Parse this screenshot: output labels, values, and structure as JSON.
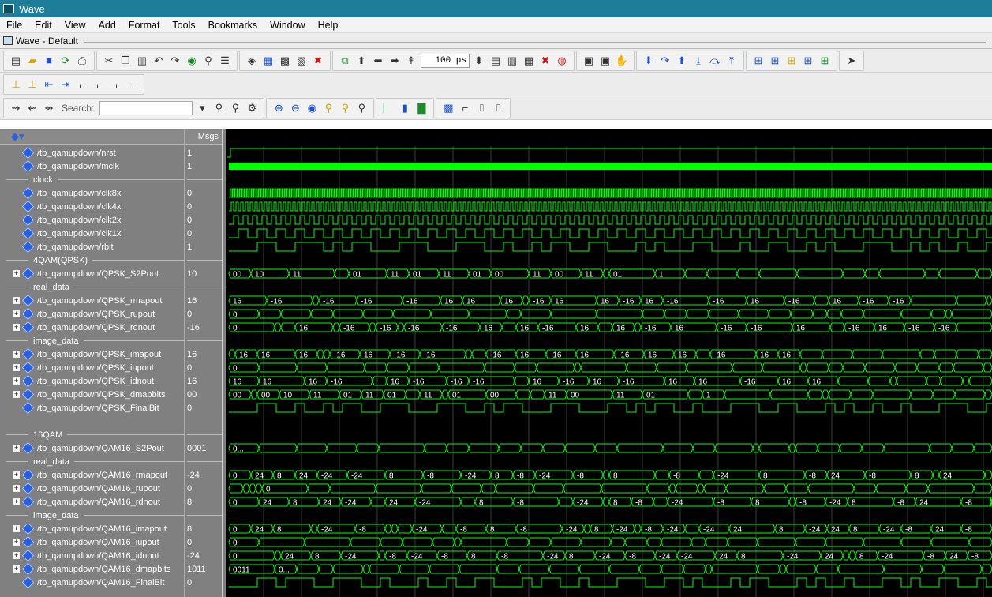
{
  "window": {
    "title": "Wave"
  },
  "menu": [
    "File",
    "Edit",
    "View",
    "Add",
    "Format",
    "Tools",
    "Bookmarks",
    "Window",
    "Help"
  ],
  "pane": {
    "title": "Wave - Default"
  },
  "toolbar": {
    "time_value": "100 ps",
    "search_label": "Search:"
  },
  "columns": {
    "msgs": "Msgs"
  },
  "colors": {
    "wave": "#00ff00",
    "background": "#000000",
    "panel": "#808080"
  },
  "signals": [
    {
      "type": "sig",
      "name": "/tb_qamupdown/nrst",
      "value": "1",
      "expand": false,
      "kind": "bit",
      "pattern": "nrst"
    },
    {
      "type": "sig",
      "name": "/tb_qamupdown/mclk",
      "value": "1",
      "expand": false,
      "kind": "bit",
      "pattern": "mclk"
    },
    {
      "type": "div",
      "name": "clock"
    },
    {
      "type": "sig",
      "name": "/tb_qamupdown/clk8x",
      "value": "0",
      "expand": false,
      "kind": "bit",
      "pattern": "clk8x"
    },
    {
      "type": "sig",
      "name": "/tb_qamupdown/clk4x",
      "value": "0",
      "expand": false,
      "kind": "bit",
      "pattern": "clk4x"
    },
    {
      "type": "sig",
      "name": "/tb_qamupdown/clk2x",
      "value": "0",
      "expand": false,
      "kind": "bit",
      "pattern": "clk2x"
    },
    {
      "type": "sig",
      "name": "/tb_qamupdown/clk1x",
      "value": "0",
      "expand": false,
      "kind": "bit",
      "pattern": "clk1x"
    },
    {
      "type": "sig",
      "name": "/tb_qamupdown/rbit",
      "value": "1",
      "expand": false,
      "kind": "bit",
      "pattern": "rbit"
    },
    {
      "type": "div",
      "name": "4QAM(QPSK)"
    },
    {
      "type": "sig",
      "name": "/tb_qamupdown/QPSK_S2Pout",
      "value": "10",
      "expand": true,
      "kind": "bus",
      "labels": [
        "00",
        "10",
        "11",
        "01",
        "11",
        "01",
        "11",
        "01",
        "00",
        "11",
        "00",
        "11",
        "01",
        "1"
      ]
    },
    {
      "type": "div",
      "name": "real_data"
    },
    {
      "type": "sig",
      "name": "/tb_qamupdown/QPSK_rmapout",
      "value": "16",
      "expand": true,
      "kind": "bus",
      "labels": [
        "16",
        "-16",
        "-16",
        "-16",
        "-16",
        "16",
        "16",
        "16",
        "-16",
        "16",
        "16",
        "-16",
        "16",
        "-16",
        "-16",
        "16",
        "-16",
        "16",
        "-16",
        "-16"
      ]
    },
    {
      "type": "sig",
      "name": "/tb_qamupdown/QPSK_rupout",
      "value": "0",
      "expand": true,
      "kind": "bus",
      "labels": [
        "0"
      ]
    },
    {
      "type": "sig",
      "name": "/tb_qamupdown/QPSK_rdnout",
      "value": "-16",
      "expand": true,
      "kind": "bus",
      "labels": [
        "0",
        "16",
        "-16",
        "-16",
        "-16",
        "-16",
        "16",
        "16",
        "-16",
        "16",
        "16",
        "-16",
        "16",
        "-16",
        "-16",
        "16",
        "-16",
        "16",
        "-16",
        "-16"
      ]
    },
    {
      "type": "div",
      "name": "image_data"
    },
    {
      "type": "sig",
      "name": "/tb_qamupdown/QPSK_imapout",
      "value": "16",
      "expand": true,
      "kind": "bus",
      "labels": [
        "16",
        "16",
        "16",
        "-16",
        "16",
        "-16",
        "-16",
        "-16",
        "16",
        "-16",
        "16",
        "-16",
        "16",
        "16",
        "-16",
        "16",
        "16"
      ]
    },
    {
      "type": "sig",
      "name": "/tb_qamupdown/QPSK_iupout",
      "value": "0",
      "expand": true,
      "kind": "bus",
      "labels": [
        "0"
      ]
    },
    {
      "type": "sig",
      "name": "/tb_qamupdown/QPSK_idnout",
      "value": "16",
      "expand": true,
      "kind": "bus",
      "labels": [
        "16",
        "16",
        "16",
        "-16",
        "16",
        "-16",
        "-16",
        "-16",
        "16",
        "-16",
        "16",
        "-16",
        "16",
        "16",
        "-16",
        "16",
        "16"
      ]
    },
    {
      "type": "sig",
      "name": "/tb_qamupdown/QPSK_dmapbits",
      "value": "00",
      "expand": true,
      "kind": "bus",
      "labels": [
        "00",
        "00",
        "10",
        "11",
        "01",
        "11",
        "01",
        "11",
        "01",
        "00",
        "11",
        "00",
        "11",
        "01",
        "1"
      ]
    },
    {
      "type": "sig",
      "name": "/tb_qamupdown/QPSK_FinalBit",
      "value": "0",
      "expand": false,
      "kind": "bit",
      "pattern": "final1"
    },
    {
      "type": "spacer"
    },
    {
      "type": "div",
      "name": "16QAM"
    },
    {
      "type": "sig",
      "name": "/tb_qamupdown/QAM16_S2Pout",
      "value": "0001",
      "expand": true,
      "kind": "bus",
      "labels": [
        "0..."
      ]
    },
    {
      "type": "div",
      "name": "real_data"
    },
    {
      "type": "sig",
      "name": "/tb_qamupdown/QAM16_rmapout",
      "value": "-24",
      "expand": true,
      "kind": "bus",
      "labels": [
        "0",
        "24",
        "8",
        "24",
        "-24",
        "-24",
        "8",
        "-8",
        "-24",
        "8",
        "-8",
        "-24",
        "-8",
        "8",
        "-8",
        "-24",
        "8",
        "-8",
        "24",
        "-8",
        "8",
        "24",
        "-24",
        "24",
        "-8",
        "24"
      ]
    },
    {
      "type": "sig",
      "name": "/tb_qamupdown/QAM16_rupout",
      "value": "0",
      "expand": true,
      "kind": "bus",
      "labels": [
        "0"
      ]
    },
    {
      "type": "sig",
      "name": "/tb_qamupdown/QAM16_rdnout",
      "value": "8",
      "expand": true,
      "kind": "bus",
      "labels": [
        "0",
        "24",
        "8",
        "24",
        "-24",
        "24",
        "-24",
        "8",
        "-8",
        "-24",
        "8",
        "-8",
        "-24",
        "-8",
        "8",
        "-8",
        "-24",
        "8",
        "-8",
        "24",
        "-8",
        "8",
        "24",
        "-24",
        "24",
        "-8"
      ]
    },
    {
      "type": "div",
      "name": "image_data"
    },
    {
      "type": "sig",
      "name": "/tb_qamupdown/QAM16_imapout",
      "value": "8",
      "expand": true,
      "kind": "bus",
      "labels": [
        "0",
        "24",
        "8",
        "-24",
        "-8",
        "-24",
        "-8",
        "8",
        "-8",
        "-24",
        "8",
        "-24",
        "-8",
        "-24",
        "-24",
        "24",
        "8",
        "-24",
        "24",
        "8",
        "-24",
        "-8",
        "24",
        "-8",
        "24",
        "-8",
        "8"
      ]
    },
    {
      "type": "sig",
      "name": "/tb_qamupdown/QAM16_iupout",
      "value": "0",
      "expand": true,
      "kind": "bus",
      "labels": [
        "0"
      ]
    },
    {
      "type": "sig",
      "name": "/tb_qamupdown/QAM16_idnout",
      "value": "-24",
      "expand": true,
      "kind": "bus",
      "labels": [
        "0",
        "24",
        "8",
        "-24",
        "-8",
        "-24",
        "-8",
        "8",
        "-8",
        "-24",
        "8",
        "-24",
        "-8",
        "-24",
        "-24",
        "24",
        "8",
        "-24",
        "24",
        "8",
        "-24",
        "-8",
        "24",
        "-8",
        "24",
        "-8"
      ]
    },
    {
      "type": "sig",
      "name": "/tb_qamupdown/QAM16_dmapbits",
      "value": "1011",
      "expand": true,
      "kind": "bus",
      "labels": [
        "0011",
        "0..."
      ]
    },
    {
      "type": "sig",
      "name": "/tb_qamupdown/QAM16_FinalBit",
      "value": "0",
      "expand": false,
      "kind": "bit",
      "pattern": "final2"
    }
  ]
}
